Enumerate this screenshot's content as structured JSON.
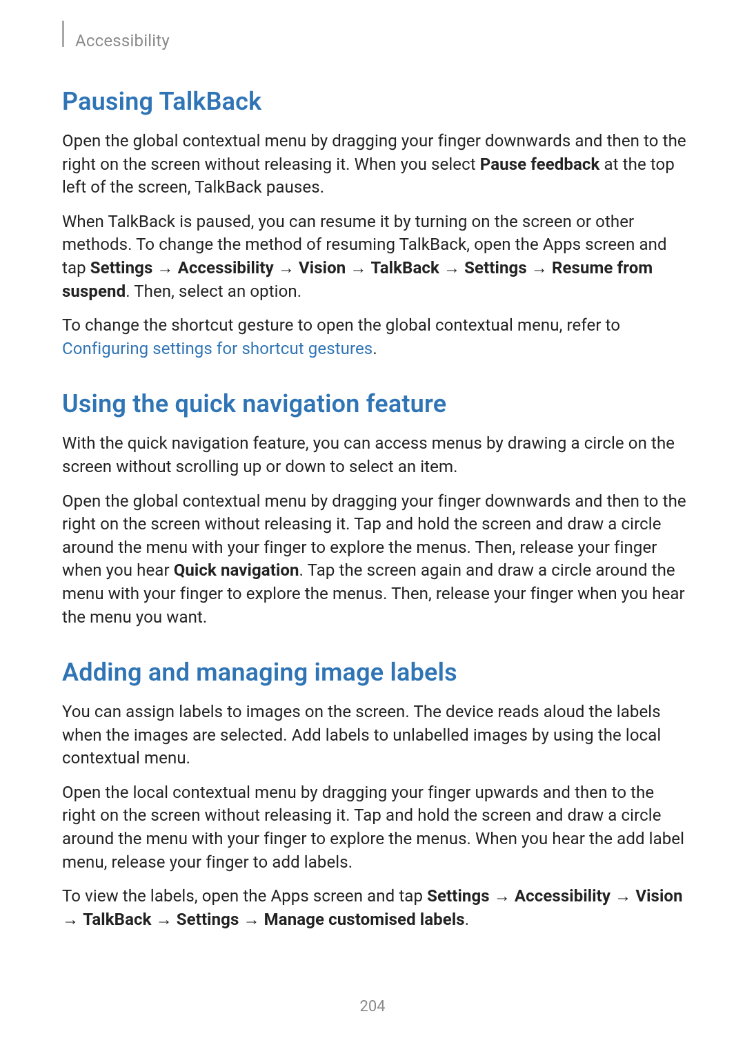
{
  "header": {
    "chapter": "Accessibility"
  },
  "sections": [
    {
      "heading": "Pausing TalkBack",
      "paragraphs": [
        {
          "parts": [
            {
              "t": "Open the global contextual menu by dragging your finger downwards and then to the right on the screen without releasing it. When you select "
            },
            {
              "t": "Pause feedback",
              "b": true
            },
            {
              "t": " at the top left of the screen, TalkBack pauses."
            }
          ]
        },
        {
          "parts": [
            {
              "t": "When TalkBack is paused, you can resume it by turning on the screen or other methods. To change the method of resuming TalkBack, open the Apps screen and tap "
            },
            {
              "t": "Settings",
              "b": true
            },
            {
              "t": " → "
            },
            {
              "t": "Accessibility",
              "b": true
            },
            {
              "t": " → "
            },
            {
              "t": "Vision",
              "b": true
            },
            {
              "t": " → "
            },
            {
              "t": "TalkBack",
              "b": true
            },
            {
              "t": " → "
            },
            {
              "t": "Settings",
              "b": true
            },
            {
              "t": " → "
            },
            {
              "t": "Resume from suspend",
              "b": true
            },
            {
              "t": ". Then, select an option."
            }
          ]
        },
        {
          "parts": [
            {
              "t": "To change the shortcut gesture to open the global contextual menu, refer to "
            },
            {
              "t": "Configuring settings for shortcut gestures",
              "link": true
            },
            {
              "t": "."
            }
          ]
        }
      ]
    },
    {
      "heading": "Using the quick navigation feature",
      "paragraphs": [
        {
          "parts": [
            {
              "t": "With the quick navigation feature, you can access menus by drawing a circle on the screen without scrolling up or down to select an item."
            }
          ]
        },
        {
          "parts": [
            {
              "t": "Open the global contextual menu by dragging your finger downwards and then to the right on the screen without releasing it. Tap and hold the screen and draw a circle around the menu with your finger to explore the menus. Then, release your finger when you hear "
            },
            {
              "t": "Quick navigation",
              "b": true
            },
            {
              "t": ". Tap the screen again and draw a circle around the menu with your finger to explore the menus. Then, release your finger when you hear the menu you want."
            }
          ]
        }
      ]
    },
    {
      "heading": "Adding and managing image labels",
      "paragraphs": [
        {
          "parts": [
            {
              "t": "You can assign labels to images on the screen. The device reads aloud the labels when the images are selected. Add labels to unlabelled images by using the local contextual menu."
            }
          ]
        },
        {
          "parts": [
            {
              "t": "Open the local contextual menu by dragging your finger upwards and then to the right on the screen without releasing it. Tap and hold the screen and draw a circle around the menu with your finger to explore the menus. When you hear the add label menu, release your finger to add labels."
            }
          ]
        },
        {
          "parts": [
            {
              "t": "To view the labels, open the Apps screen and tap "
            },
            {
              "t": "Settings",
              "b": true
            },
            {
              "t": " → "
            },
            {
              "t": "Accessibility",
              "b": true
            },
            {
              "t": " → "
            },
            {
              "t": "Vision",
              "b": true
            },
            {
              "t": " → "
            },
            {
              "t": "TalkBack",
              "b": true
            },
            {
              "t": " → "
            },
            {
              "t": "Settings",
              "b": true
            },
            {
              "t": " → "
            },
            {
              "t": "Manage customised labels",
              "b": true
            },
            {
              "t": "."
            }
          ]
        }
      ]
    }
  ],
  "pageNumber": "204"
}
